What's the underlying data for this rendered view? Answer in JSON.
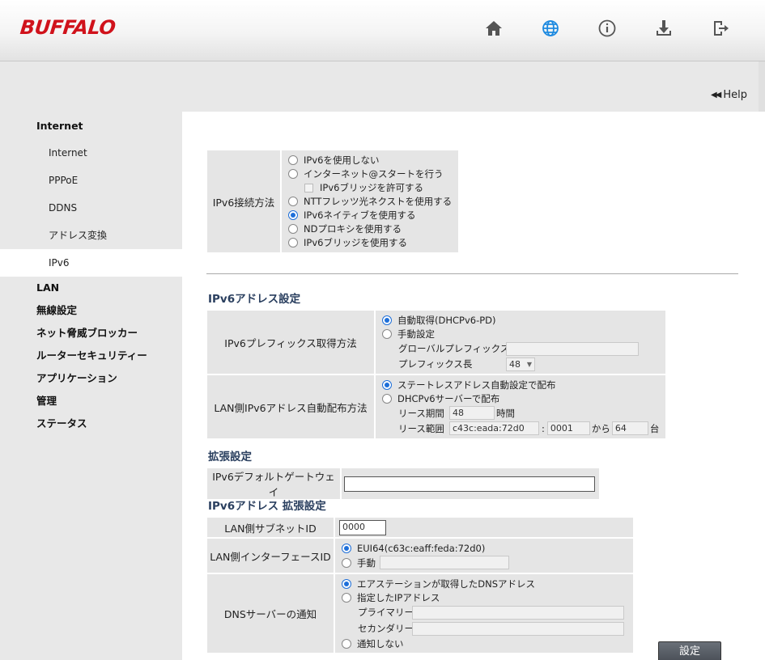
{
  "header": {
    "logo": "BUFFALO",
    "icons": [
      "home-icon",
      "globe-icon",
      "info-icon",
      "download-icon",
      "logout-icon"
    ],
    "accent": "#1e8ae0",
    "brand_color": "#d0121b"
  },
  "help": {
    "arrows": "◀◀",
    "label": "Help"
  },
  "sidebar": {
    "internet": "Internet",
    "sub": [
      "Internet",
      "PPPoE",
      "DDNS",
      "アドレス変換",
      "IPv6"
    ],
    "items": [
      "LAN",
      "無線設定",
      "ネット脅威ブロッカー",
      "ルーターセキュリティー",
      "アプリケーション",
      "管理",
      "ステータス"
    ]
  },
  "ipv6_conn": {
    "label": "IPv6接続方法",
    "options": [
      "IPv6を使用しない",
      "インターネット@スタートを行う",
      "IPv6ブリッジを許可する",
      "NTTフレッツ光ネクストを使用する",
      "IPv6ネイティブを使用する",
      "NDプロキシを使用する",
      "IPv6ブリッジを使用する"
    ]
  },
  "addr_section": {
    "title": "IPv6アドレス設定",
    "prefix_label": "IPv6プレフィックス取得方法",
    "prefix_auto": "自動取得(DHCPv6-PD)",
    "prefix_manual": "手動設定",
    "global_prefix": "グローバルプレフィックス",
    "prefix_len": "プレフィックス長",
    "prefix_len_value": "48",
    "lan_label": "LAN側IPv6アドレス自動配布方法",
    "stateless": "ステートレスアドレス自動設定で配布",
    "dhcpv6": "DHCPv6サーバーで配布",
    "lease_period": "リース期間",
    "lease_value": "48",
    "hours": "時間",
    "lease_range": "リース範囲",
    "range_prefix": "c43c:eada:72d0",
    "colon": ":",
    "range_start": "0001",
    "from": "から",
    "range_count": "64",
    "units": "台"
  },
  "ext_section": {
    "title": "拡張設定",
    "gateway_label": "IPv6デフォルトゲートウェイ",
    "gateway_value": ""
  },
  "ext_addr": {
    "title": "IPv6アドレス 拡張設定",
    "subnet_label": "LAN側サブネットID",
    "subnet_value": "0000",
    "iface_label": "LAN側インターフェースID",
    "eui64": "EUI64(c63c:eaff:feda:72d0)",
    "manual": "手動",
    "dns_label": "DNSサーバーの通知",
    "dns_acquired": "エアステーションが取得したDNSアドレス",
    "dns_specified": "指定したIPアドレス",
    "primary": "プライマリー",
    "secondary": "セカンダリー",
    "dns_none": "通知しない"
  },
  "submit": "設定"
}
